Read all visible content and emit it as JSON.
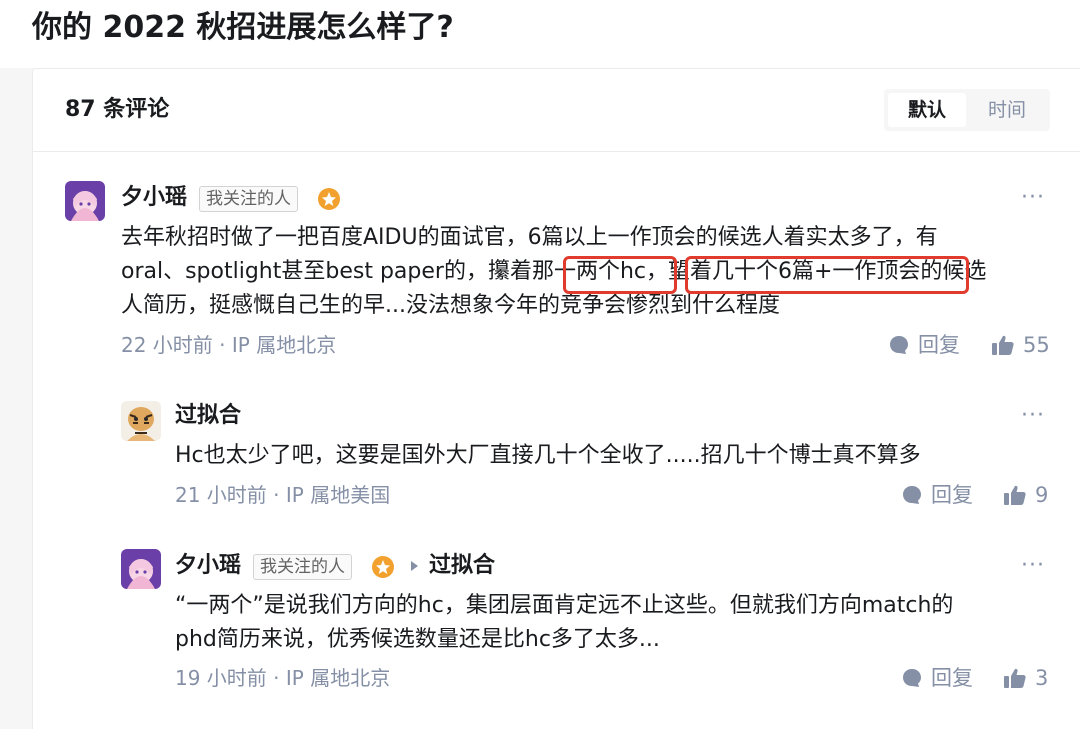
{
  "question": {
    "title": "你的 2022 秋招进展怎么样了?"
  },
  "comments_header": {
    "count_label": "87 条评论",
    "sort_options": [
      "默认",
      "时间"
    ],
    "active_sort": "默认"
  },
  "comments": [
    {
      "author": "夕小瑶",
      "tag": "我关注的人",
      "has_badge": true,
      "text_lines": [
        "去年秋招时做了一把百度AIDU的面试官，6篇以上一作顶会的候选人着实太多了，有",
        "oral、spotlight甚至best paper的，攥着那一两个hc，望着几十个6篇+一作顶会的候选",
        "人简历，挺感慨自己生的早...没法想象今年的竞争会惨烈到什么程度"
      ],
      "highlights": [
        "一两个hc",
        "望着几十个6篇+一作顶会"
      ],
      "meta": "22 小时前 · IP 属地北京",
      "reply_label": "回复",
      "likes": "55"
    },
    {
      "author": "过拟合",
      "text_lines": [
        "Hc也太少了吧，这要是国外大厂直接几十个全收了.....招几十个博士真不算多"
      ],
      "meta": "21 小时前 · IP 属地美国",
      "reply_label": "回复",
      "likes": "9"
    },
    {
      "author": "夕小瑶",
      "tag": "我关注的人",
      "has_badge": true,
      "reply_to": "过拟合",
      "text_lines": [
        "“一两个”是说我们方向的hc，集团层面肯定远不止这些。但就我们方向match的",
        "phd简历来说，优秀候选数量还是比hc多了太多..."
      ],
      "meta": "19 小时前 · IP 属地北京",
      "reply_label": "回复",
      "likes": "3"
    }
  ],
  "colors": {
    "highlight_box": "#e13b2e",
    "badge": "#f2a12e",
    "meta": "#8590a6"
  },
  "icons": [
    "more-icon",
    "reply-icon",
    "like-icon",
    "badge-icon",
    "arrow-icon"
  ]
}
